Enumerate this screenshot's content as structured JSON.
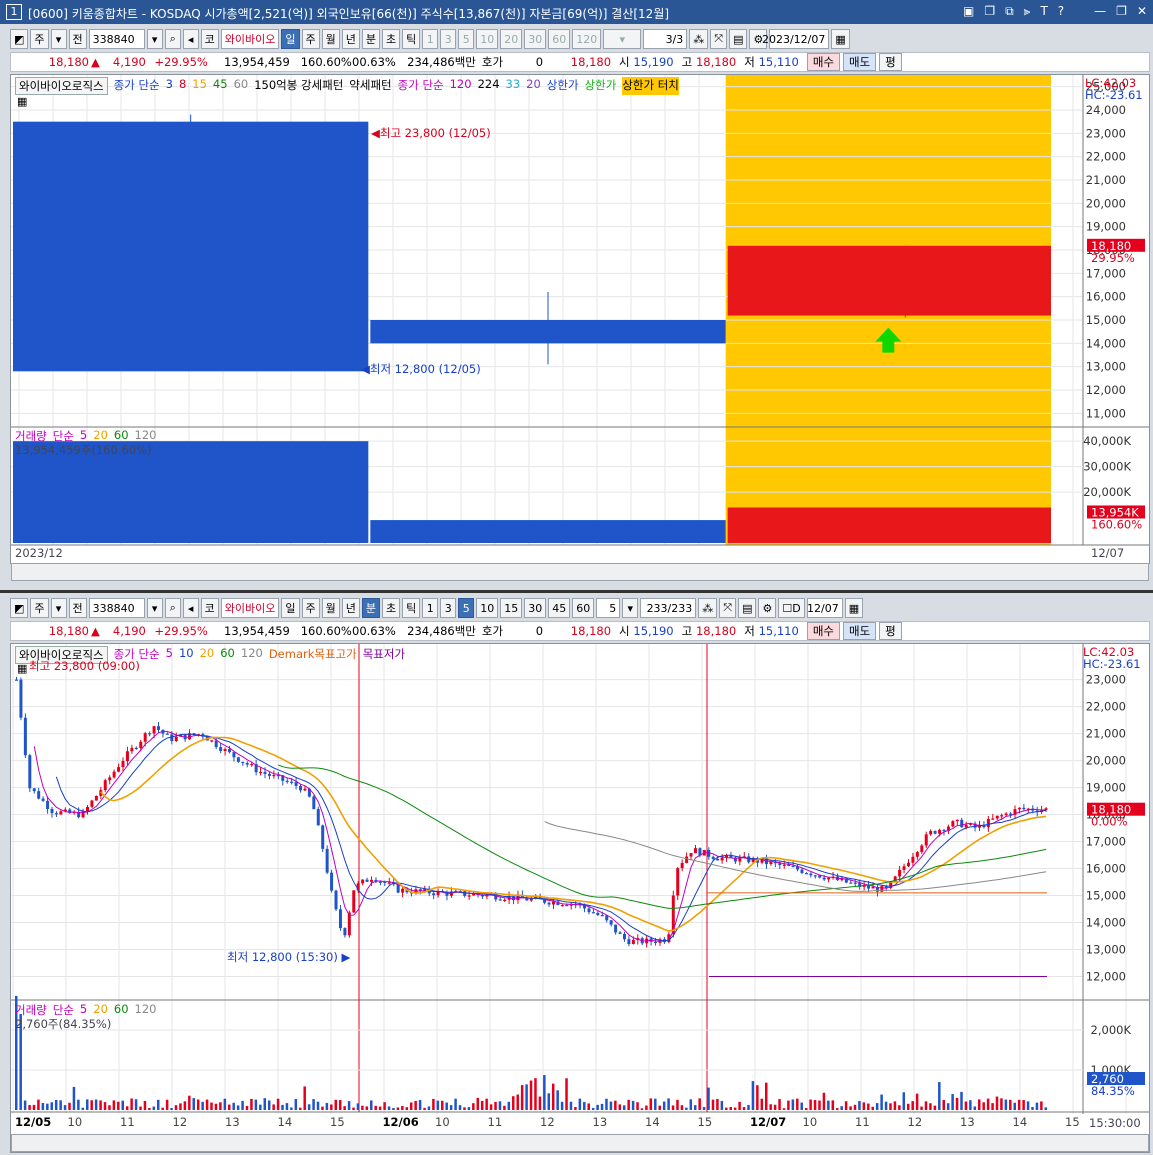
{
  "window": {
    "number": "1",
    "title": "[0600] 키움종합차트 - KOSDAQ 시가총액[2,521(억)] 외국인보유[66(천)] 주식수[13,867(천)] 자본금[69(억)] 결산[12월]",
    "icons": [
      "layout-icon",
      "copy-icon",
      "pin-icon",
      "T",
      "?"
    ],
    "buttons": [
      "minimize",
      "restore",
      "close"
    ]
  },
  "top": {
    "toolbar": {
      "type1": "주",
      "type2": "전",
      "code": "338840",
      "market": "코",
      "name": "와이바이오",
      "periods": [
        "일",
        "주",
        "월",
        "년",
        "분",
        "초",
        "틱"
      ],
      "selected_period": "일",
      "nums": [
        "1",
        "3",
        "5",
        "10",
        "20",
        "30",
        "60",
        "120"
      ],
      "count": "3/3",
      "date": "2023/12/07"
    },
    "quote": {
      "price": "18,180",
      "change": "4,190",
      "rate": "+29.95%",
      "volume": "13,954,459",
      "vol_rate": "160.60%",
      "turnover": "00.63%",
      "amount": "234,486백만",
      "hoga_label": "호가",
      "hoga": "0",
      "hoga_price": "18,180",
      "open_label": "시",
      "open": "15,190",
      "high_label": "고",
      "high": "18,180",
      "low_label": "저",
      "low": "15,110",
      "buy": "매수",
      "sell": "매도",
      "avg": "평"
    },
    "legend": {
      "indicator": "와이바이오로직스",
      "ma_label": "종가 단순",
      "ma": [
        "3",
        "8",
        "15",
        "45",
        "60"
      ],
      "pattern1": "150억봉 강세패턴",
      "pattern2": "약세패턴",
      "ma2_label": "종가 단순",
      "ma2": [
        "120",
        "224",
        "33",
        "20"
      ],
      "limit_up": "상한가",
      "limit_up2": "상한가",
      "limit_touch": "상한가 터치"
    },
    "lc": "LC:42.03",
    "hc": "HC:-23.61",
    "yticks": [
      "25,000",
      "24,000",
      "23,000",
      "22,000",
      "21,000",
      "20,000",
      "19,000",
      "18,000",
      "17,000",
      "16,000",
      "15,000",
      "14,000",
      "13,000",
      "12,000",
      "11,000"
    ],
    "price_box": "18,180",
    "price_box_rate": "29.95%",
    "max_label": "최고 23,800 (12/05)",
    "min_label": "최저 12,800 (12/05)",
    "vol_legend": {
      "label": "거래량",
      "ma_label": "단순",
      "ma": [
        "5",
        "20",
        "60",
        "120"
      ]
    },
    "vol_value": "13,954,459주(160.60%)",
    "vol_ticks": [
      "40,000K",
      "30,000K",
      "20,000K"
    ],
    "vol_box": "13,954K",
    "vol_box_rate": "160.60%",
    "x_left": "2023/12",
    "x_right": "12/07",
    "chart_data": {
      "type": "candlestick",
      "dates": [
        "12/05",
        "12/06",
        "12/07"
      ],
      "open": [
        23500,
        15000,
        15190
      ],
      "high": [
        23800,
        16200,
        18180
      ],
      "low": [
        12800,
        13100,
        15110
      ],
      "close": [
        12800,
        14000,
        18180
      ],
      "volume_k": [
        40000,
        9000,
        13954
      ],
      "ylim": [
        10500,
        25500
      ]
    }
  },
  "bottom": {
    "toolbar": {
      "type1": "주",
      "type2": "전",
      "code": "338840",
      "market": "코",
      "name": "와이바이오",
      "periods": [
        "일",
        "주",
        "월",
        "년",
        "분",
        "초",
        "틱"
      ],
      "selected_period": "분",
      "nums": [
        "1",
        "3",
        "5",
        "10",
        "15",
        "30",
        "45",
        "60"
      ],
      "selected_num": "5",
      "interval": "5",
      "count": "233/233",
      "date": "12/07"
    },
    "quote": {
      "price": "18,180",
      "change": "4,190",
      "rate": "+29.95%",
      "volume": "13,954,459",
      "vol_rate": "160.60%",
      "turnover": "00.63%",
      "amount": "234,486백만",
      "hoga_label": "호가",
      "hoga": "0",
      "hoga_price": "18,180",
      "open_label": "시",
      "open": "15,190",
      "high_label": "고",
      "high": "18,180",
      "low_label": "저",
      "low": "15,110",
      "buy": "매수",
      "sell": "매도",
      "avg": "평"
    },
    "legend": {
      "indicator": "와이바이오로직스",
      "ma_label": "종가 단순",
      "ma": [
        "5",
        "10",
        "20",
        "60",
        "120"
      ],
      "demark": "Demark목표고가",
      "demark_low": "목표저가"
    },
    "lc": "LC:42.03",
    "hc": "HC:-23.61",
    "yticks": [
      "23,000",
      "22,000",
      "21,000",
      "20,000",
      "19,000",
      "18,000",
      "17,000",
      "16,000",
      "15,000",
      "14,000",
      "13,000",
      "12,000"
    ],
    "price_box": "18,180",
    "price_box_rate": "0.00%",
    "max_label": "최고 23,800 (09:00)",
    "min_label": "최저 12,800 (15:30)",
    "vol_legend": {
      "label": "거래량",
      "ma_label": "단순",
      "ma": [
        "5",
        "20",
        "60",
        "120"
      ]
    },
    "vol_value": "2,760주(84.35%)",
    "vol_ticks": [
      "2,000K",
      "1,000K"
    ],
    "vol_box": "2,760",
    "vol_box_rate": "84.35%",
    "x_labels": [
      "12/05",
      "10",
      "11",
      "12",
      "13",
      "14",
      "15",
      "12/06",
      "10",
      "11",
      "12",
      "13",
      "14",
      "15",
      "12/07",
      "10",
      "11",
      "12",
      "13",
      "14",
      "15"
    ],
    "x_time": "15:30:00",
    "chart_data": {
      "type": "candlestick",
      "ylim": [
        11500,
        23800
      ],
      "ma_series": [
        "MA5",
        "MA10",
        "MA20",
        "MA60",
        "MA120"
      ]
    }
  },
  "colors": {
    "up": "#e4001c",
    "down": "#1f55c8",
    "band": "#ffc800",
    "limit": "#e8181a",
    "arrow": "#12d600"
  }
}
